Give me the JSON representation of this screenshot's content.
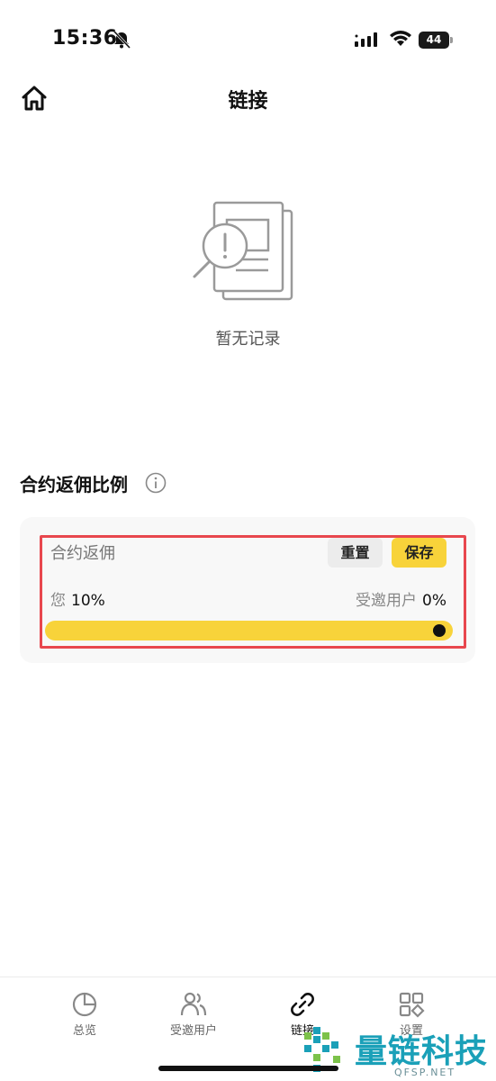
{
  "status_bar": {
    "time": "15:36",
    "battery": "44"
  },
  "header": {
    "title": "链接"
  },
  "empty_state": {
    "text": "暂无记录"
  },
  "section": {
    "title": "合约返佣比例"
  },
  "card": {
    "label": "合约返佣",
    "reset_label": "重置",
    "save_label": "保存",
    "you_label": "您",
    "you_value": "10%",
    "invitee_label": "受邀用户",
    "invitee_value": "0%",
    "slider_value_percent": 100
  },
  "tab_bar": {
    "tabs": [
      {
        "label": "总览",
        "icon": "pie-chart-icon"
      },
      {
        "label": "受邀用户",
        "icon": "users-icon"
      },
      {
        "label": "链接",
        "icon": "link-icon"
      },
      {
        "label": "设置",
        "icon": "grid-icon"
      }
    ],
    "active_index": 2
  },
  "watermark": {
    "text": "量链科技",
    "sub": "QFSP.NET"
  },
  "colors": {
    "accent": "#f8d33a",
    "highlight": "#e8474e",
    "watermark": "#1aa0b8"
  }
}
